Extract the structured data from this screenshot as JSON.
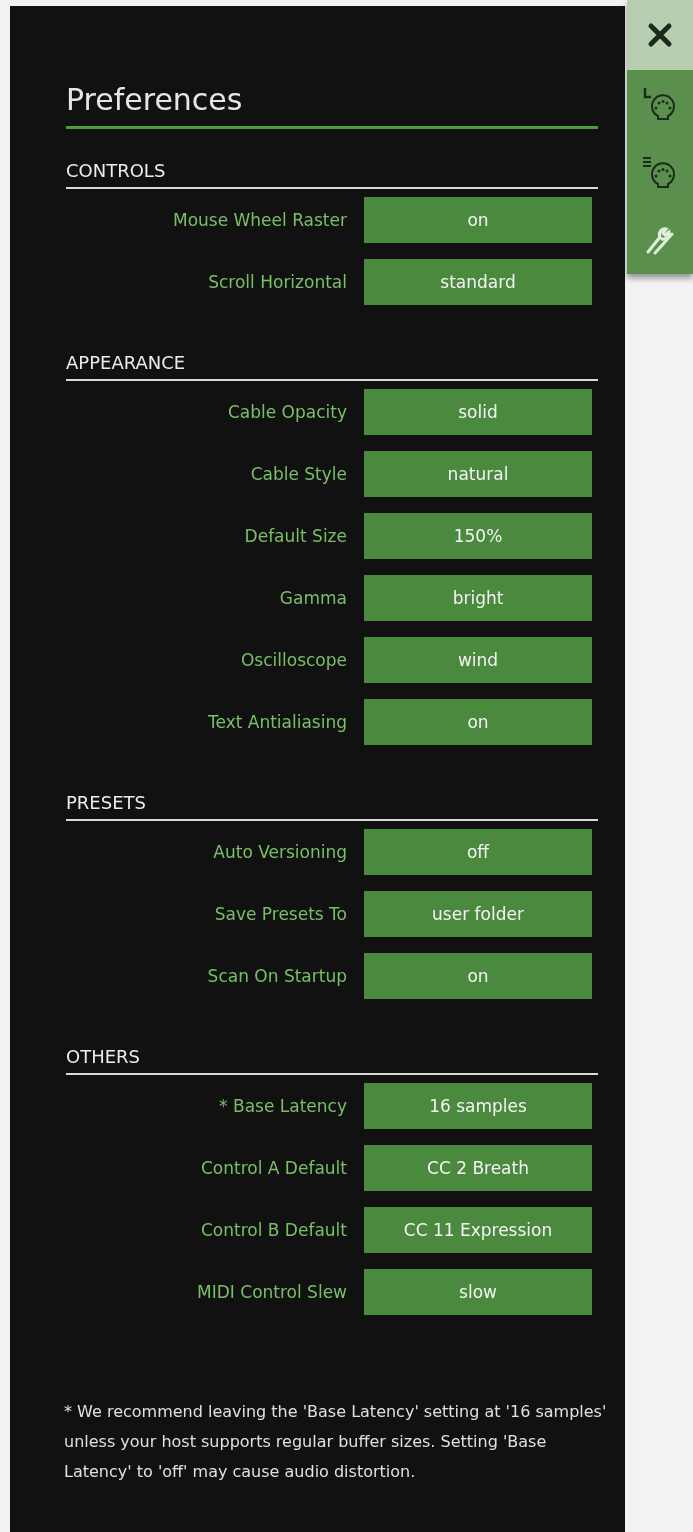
{
  "title": "Preferences",
  "sidebar_buttons": [
    {
      "kind": "close"
    },
    {
      "kind": "midi-learn"
    },
    {
      "kind": "midi-list"
    },
    {
      "kind": "tools"
    }
  ],
  "sections": [
    {
      "heading": "CONTROLS",
      "rows": [
        {
          "label": "Mouse Wheel Raster",
          "value": "on"
        },
        {
          "label": "Scroll Horizontal",
          "value": "standard"
        }
      ]
    },
    {
      "heading": "APPEARANCE",
      "rows": [
        {
          "label": "Cable Opacity",
          "value": "solid"
        },
        {
          "label": "Cable Style",
          "value": "natural"
        },
        {
          "label": "Default Size",
          "value": "150%"
        },
        {
          "label": "Gamma",
          "value": "bright"
        },
        {
          "label": "Oscilloscope",
          "value": "wind"
        },
        {
          "label": "Text Antialiasing",
          "value": "on"
        }
      ]
    },
    {
      "heading": "PRESETS",
      "rows": [
        {
          "label": "Auto Versioning",
          "value": "off"
        },
        {
          "label": "Save Presets To",
          "value": "user folder"
        },
        {
          "label": "Scan On Startup",
          "value": "on"
        }
      ]
    },
    {
      "heading": "OTHERS",
      "rows": [
        {
          "label": "* Base Latency",
          "value": "16 samples"
        },
        {
          "label": "Control A Default",
          "value": "CC 2 Breath"
        },
        {
          "label": "Control B Default",
          "value": "CC 11 Expression"
        },
        {
          "label": "MIDI Control Slew",
          "value": "slow"
        }
      ]
    }
  ],
  "footnote": "* We recommend leaving the 'Base Latency' setting at '16 samples' unless your host supports regular buffer sizes. Setting 'Base Latency' to 'off' may cause audio distortion."
}
